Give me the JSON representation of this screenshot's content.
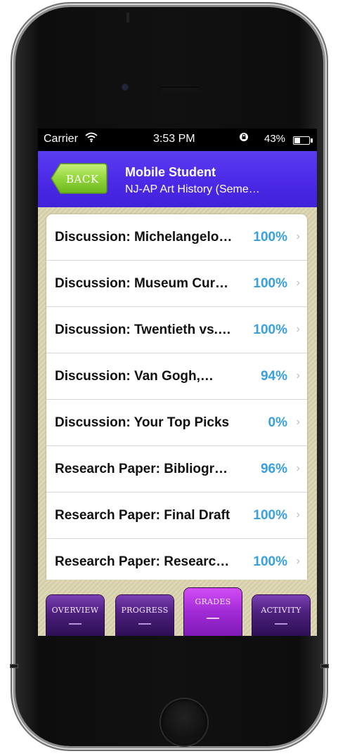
{
  "status_bar": {
    "carrier": "Carrier",
    "wifi_icon": "wifi-icon",
    "time": "3:53 PM",
    "lock_icon": "rotation-lock-icon",
    "battery_percent": "43%",
    "battery_level": 0.43
  },
  "header": {
    "back_label": "BACK",
    "title": "Mobile Student",
    "subtitle": "NJ-AP Art History (Seme…"
  },
  "grades": [
    {
      "title": "Discussion: Michelangelo…",
      "score": "100%"
    },
    {
      "title": "Discussion: Museum Cur…",
      "score": "100%"
    },
    {
      "title": "Discussion: Twentieth vs.…",
      "score": "100%"
    },
    {
      "title": "Discussion: Van Gogh,…",
      "score": "94%"
    },
    {
      "title": "Discussion: Your Top Picks",
      "score": "0%"
    },
    {
      "title": "Research Paper: Bibliogr…",
      "score": "96%"
    },
    {
      "title": "Research Paper: Final Draft",
      "score": "100%"
    },
    {
      "title": "Research Paper: Researc…",
      "score": "100%"
    }
  ],
  "tabs": [
    {
      "label": "OVERVIEW",
      "active": false
    },
    {
      "label": "PROGRESS",
      "active": false
    },
    {
      "label": "GRADES",
      "active": true
    },
    {
      "label": "ACTIVITY",
      "active": false
    }
  ],
  "colors": {
    "header_bg": "#4a28e6",
    "back_button": "#8fd43a",
    "score_text": "#37a0dd",
    "tab_active": "#a02bd6",
    "tab_inactive": "#4b1f7b"
  }
}
